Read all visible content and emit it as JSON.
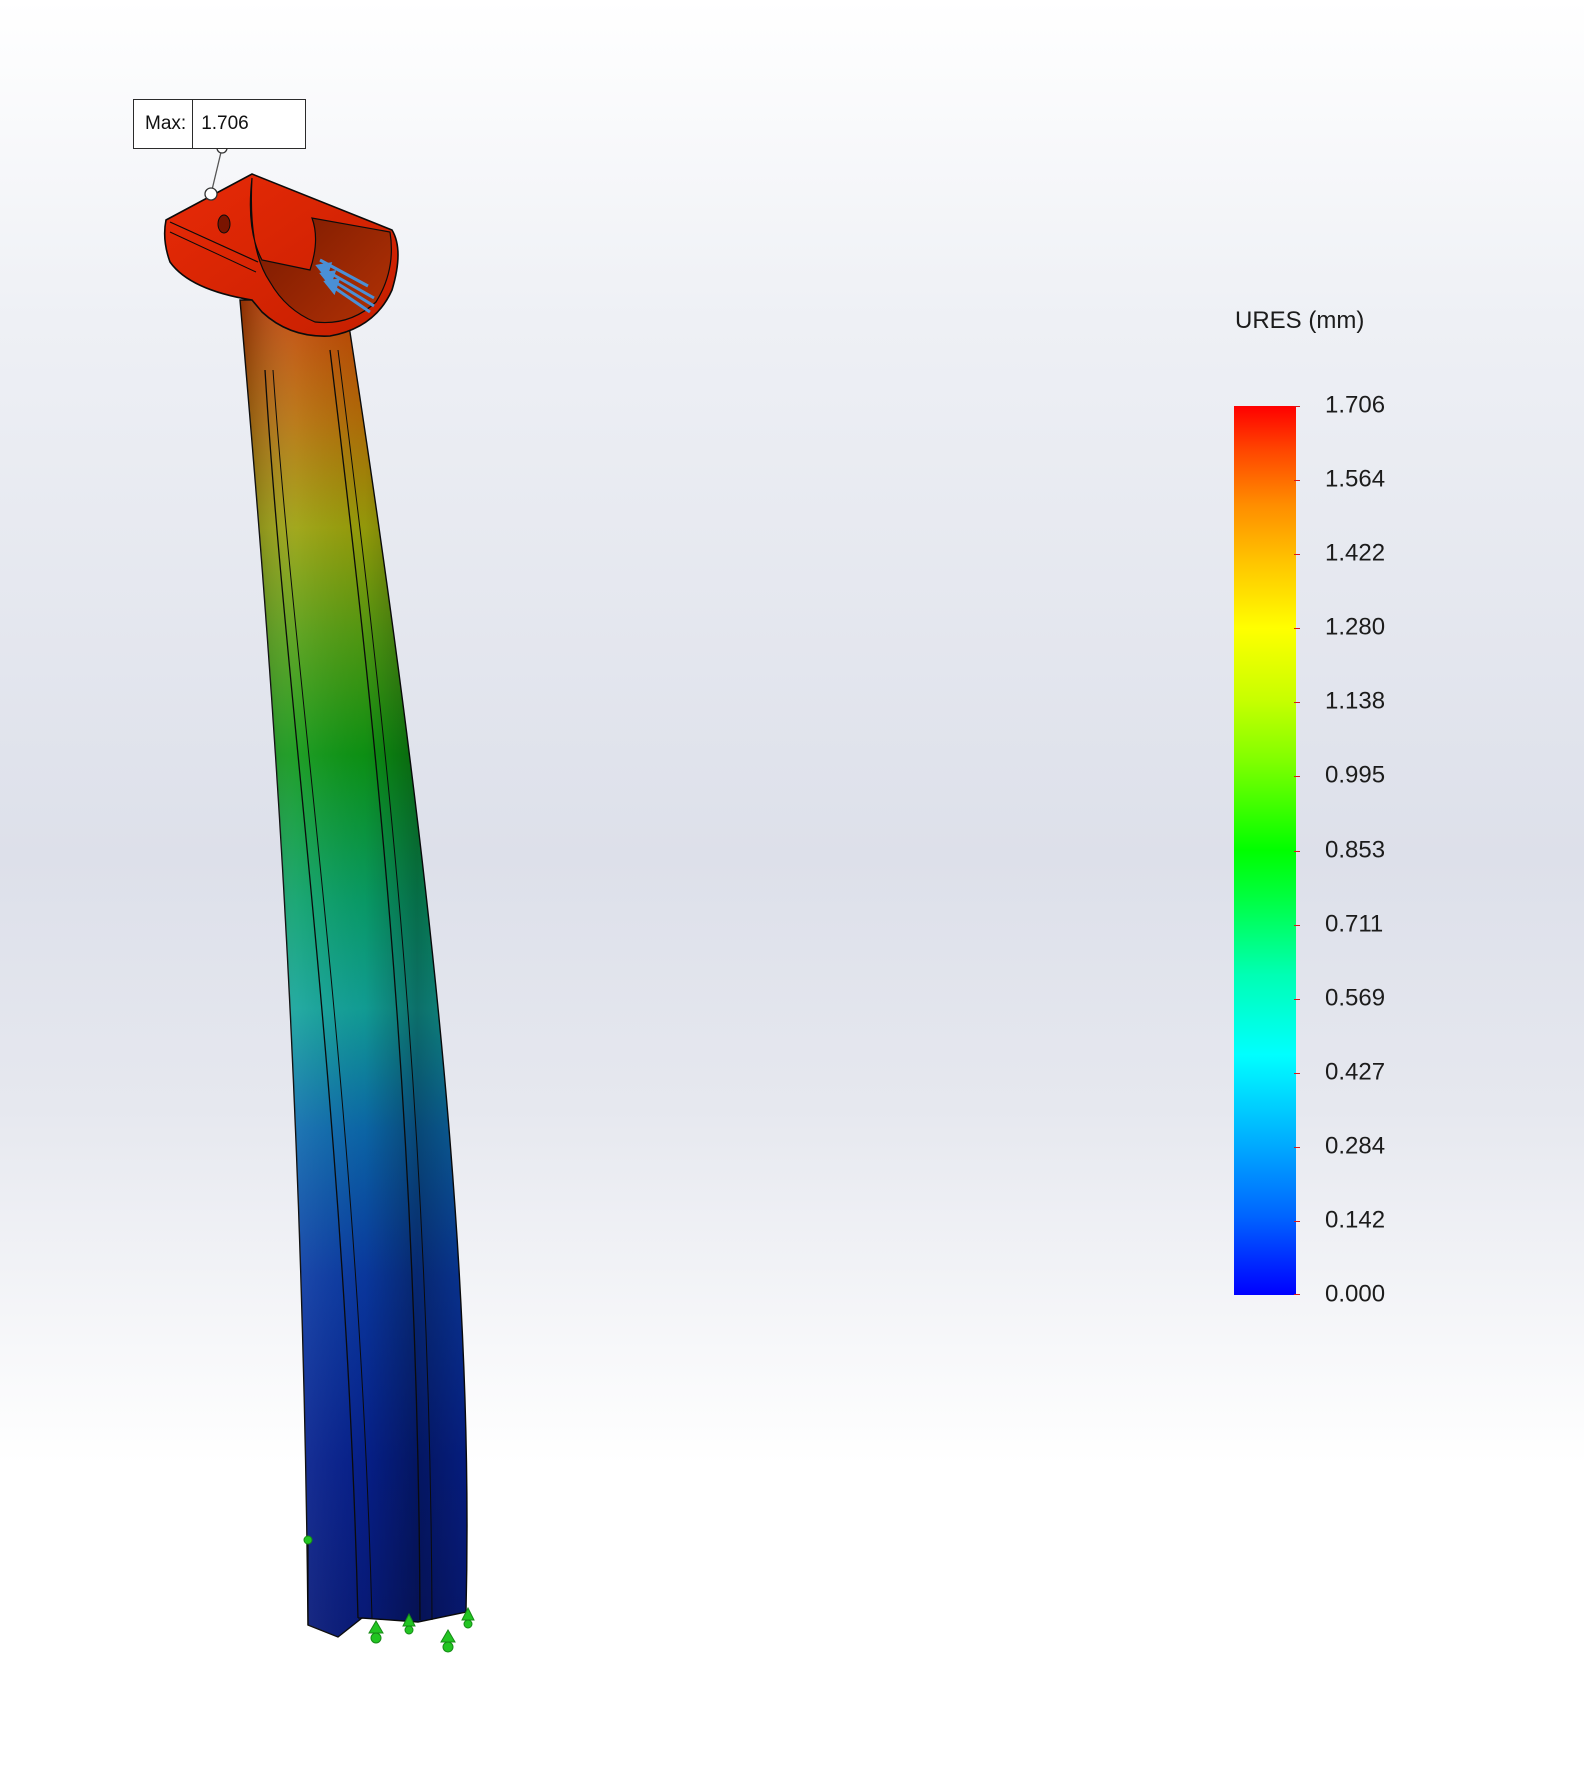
{
  "annotation": {
    "label": "Max:",
    "value": "1.706"
  },
  "legend": {
    "title": "URES (mm)",
    "labels": [
      "1.706",
      "1.564",
      "1.422",
      "1.280",
      "1.138",
      "0.995",
      "0.853",
      "0.711",
      "0.569",
      "0.427",
      "0.284",
      "0.142",
      "0.000"
    ],
    "colors": [
      "#0000ff",
      "#00ffff",
      "#00ff00",
      "#ffff00",
      "#ff0000"
    ],
    "tick_color": "#d81b1b"
  },
  "model": {
    "fixture_color": "#22c522",
    "load_arrow_color": "#4a8fd6",
    "top_color": "#d61d00",
    "bottom_color": "#0a1a8a"
  }
}
